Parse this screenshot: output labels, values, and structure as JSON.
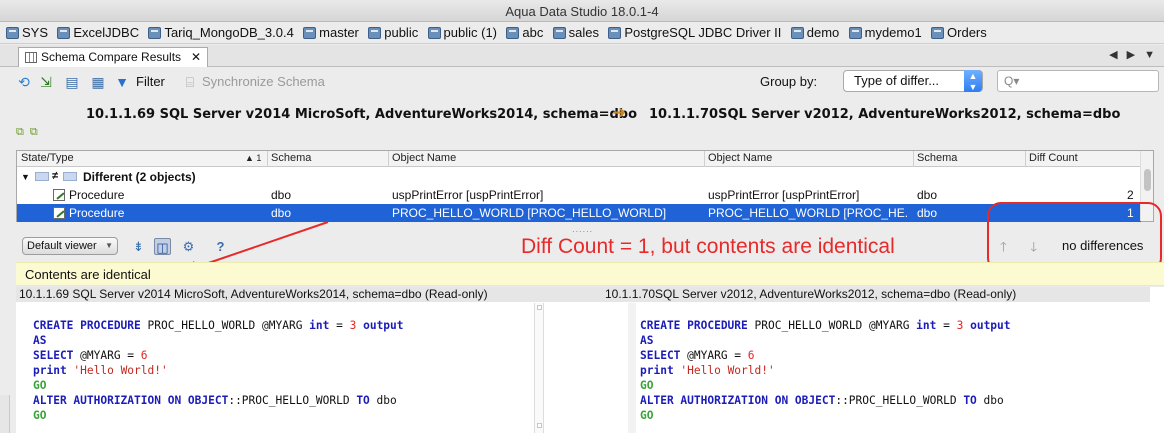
{
  "window": {
    "title": "Aqua Data Studio 18.0.1-4"
  },
  "connections": [
    "SYS",
    "ExcelJDBC",
    "Tariq_MongoDB_3.0.4",
    "master",
    "public",
    "public (1)",
    "abc",
    "sales",
    "PostgreSQL JDBC Driver II",
    "demo",
    "mydemo1",
    "Orders"
  ],
  "panel_tab": {
    "label": "Schema Compare Results",
    "close": "✕"
  },
  "nav_arrows": "◀ ▶ ▼",
  "toolbar": {
    "filter_label": "Filter",
    "sync_label": "Synchronize Schema",
    "group_by_label": "Group by:",
    "group_by_value": "Type of differ...",
    "search_placeholder": "Q▾"
  },
  "compare": {
    "left": "10.1.1.69 SQL Server v2014 MicroSoft, AdventureWorks2014,  schema=dbo",
    "right": "10.1.1.70SQL Server v2012, AdventureWorks2012,  schema=dbo",
    "arrow": "➜"
  },
  "table": {
    "columns": [
      "State/Type",
      "Schema",
      "Object Name",
      "Object Name",
      "Schema",
      "Diff Count"
    ],
    "sort_indicator": "▲ 1",
    "group": {
      "label": "Different (2 objects)",
      "toggle": "▼",
      "symbol": "≠"
    },
    "rows": [
      {
        "type": "Procedure",
        "schema_l": "dbo",
        "name_l": "uspPrintError [uspPrintError]",
        "name_r": "uspPrintError [uspPrintError]",
        "schema_r": "dbo",
        "diff": "2"
      },
      {
        "type": "Procedure",
        "schema_l": "dbo",
        "name_l": "PROC_HELLO_WORLD [PROC_HELLO_WORLD]",
        "name_r": "PROC_HELLO_WORLD [PROC_HE...",
        "schema_r": "dbo",
        "diff": "1"
      }
    ]
  },
  "viewer": {
    "default_label": "Default viewer",
    "help": "?",
    "nav_updown": "🡑 🡓",
    "status": "no differences"
  },
  "annotation": {
    "text": "Diff Count = 1, but contents are identical",
    "color": "#e8292a"
  },
  "notice": {
    "text": "Contents are identical"
  },
  "panes": {
    "left_header": "10.1.1.69 SQL Server v2014 MicroSoft, AdventureWorks2014, schema=dbo (Read-only)",
    "right_header": "10.1.1.70SQL Server v2012, AdventureWorks2012, schema=dbo (Read-only)"
  },
  "sql": {
    "create": "CREATE PROCEDURE",
    "proc": " PROC_HELLO_WORLD @MYARG ",
    "int": "int",
    "eq": " = ",
    "three": "3",
    "output": " output",
    "as": "AS",
    "select": "SELECT",
    "myarg": " @MYARG = ",
    "six": "6",
    "print": "print",
    "hello": " 'Hello World!'",
    "go": "GO",
    "alter": "ALTER AUTHORIZATION ON OBJECT",
    "alter_obj": "::PROC_HELLO_WORLD ",
    "to": "TO",
    "dbo": " dbo"
  },
  "colors": {
    "selection": "#1f63d6",
    "notice_bg": "#fbfad0",
    "keyword": "#1c1cb8",
    "literal": "#e02626",
    "go": "#3aa33a"
  }
}
